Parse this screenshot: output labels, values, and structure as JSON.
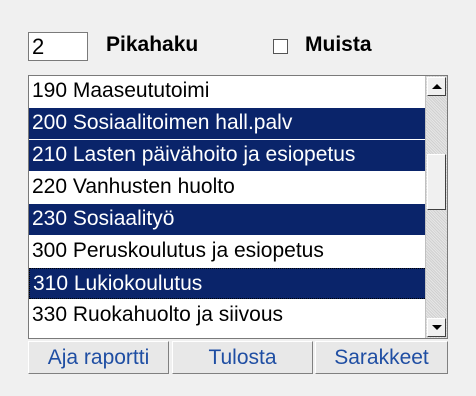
{
  "toolbar": {
    "quantity_value": "2",
    "quick_search_label": "Pikahaku",
    "remember_label": "Muista",
    "remember_checked": false
  },
  "list": {
    "items": [
      {
        "label": "190 Maaseututoimi",
        "selected": false
      },
      {
        "label": "200 Sosiaalitoimen hall.palv",
        "selected": true
      },
      {
        "label": "210 Lasten päivähoito ja esiopetus",
        "selected": true
      },
      {
        "label": "220 Vanhusten huolto",
        "selected": false
      },
      {
        "label": "230 Sosiaalityö",
        "selected": true
      },
      {
        "label": "300 Peruskoulutus ja esiopetus",
        "selected": false
      },
      {
        "label": "310 Lukiokoulutus",
        "selected": true
      },
      {
        "label": "330 Ruokahuolto ja siivous",
        "selected": false
      }
    ]
  },
  "buttons": {
    "run_report": "Aja raportti",
    "print": "Tulosta",
    "columns": "Sarakkeet"
  },
  "colors": {
    "selection": "#0a246a",
    "button_text": "#1f4ea3"
  }
}
